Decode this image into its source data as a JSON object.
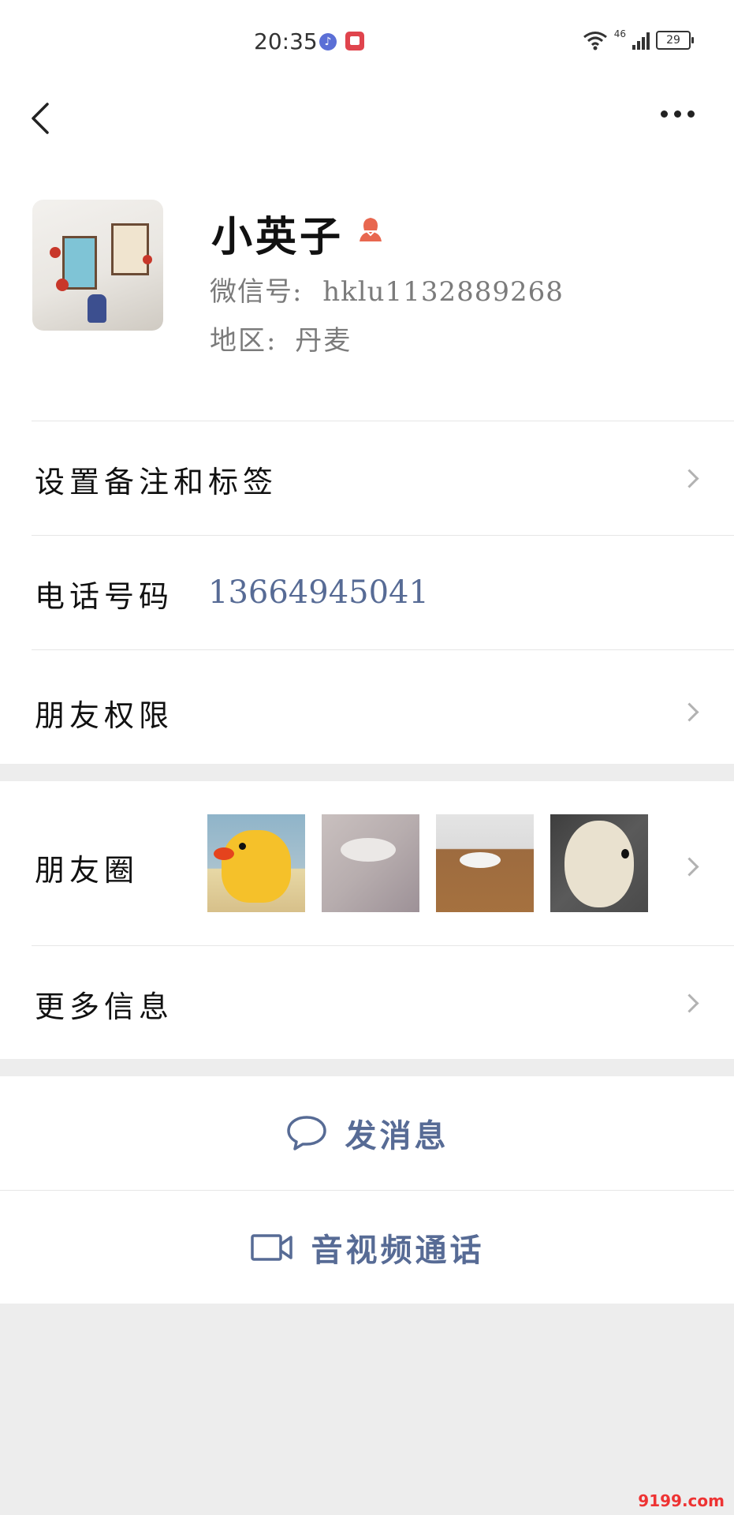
{
  "status_bar": {
    "time": "20:35",
    "network": "46",
    "battery": "29"
  },
  "profile": {
    "name": "小英子",
    "wechat_id_label": "微信号:",
    "wechat_id": "hklu1132889268",
    "region_label": "地区:",
    "region": "丹麦",
    "gender_icon": "female-icon"
  },
  "rows": {
    "remark_tags": "设置备注和标签",
    "phone_label": "电话号码",
    "phone_value": "13664945041",
    "friend_permissions": "朋友权限",
    "moments": "朋友圈",
    "more_info": "更多信息"
  },
  "actions": {
    "send_message": "发消息",
    "video_call": "音视频通话"
  },
  "watermark": "9199.com",
  "colors": {
    "link_blue": "#576b95",
    "background": "#ededed",
    "gender_accent": "#e8674f"
  }
}
